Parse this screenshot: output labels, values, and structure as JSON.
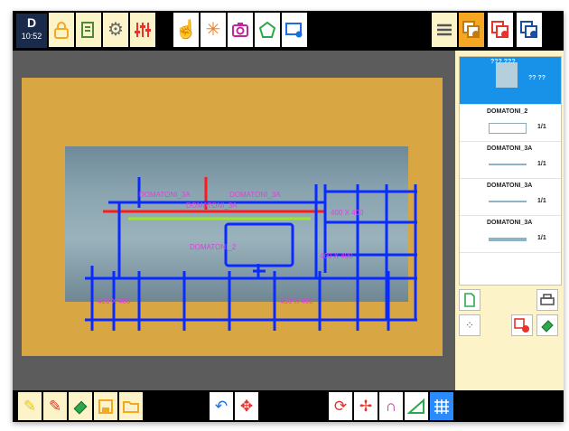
{
  "status": {
    "time": "10:52",
    "logo": "D"
  },
  "toolbar": {
    "lock_icon": "lock-icon",
    "menu_icon": "hamburger-icon"
  },
  "canvas": {
    "labels": [
      "DOMATONI_3A",
      "DOMATONI_3A",
      "DOMATONI_3A",
      "DOMATONI_2",
      "400 X 400",
      "400 X 400",
      "400 X 400",
      "400 X 400"
    ]
  },
  "layers": [
    {
      "name": "??? ???",
      "count": "?? ??"
    },
    {
      "name": "DOMATONI_2",
      "count": "1/1"
    },
    {
      "name": "DOMATONI_3A",
      "count": "1/1"
    },
    {
      "name": "DOMATONI_3A",
      "count": "1/1"
    },
    {
      "name": "DOMATONI_3A",
      "count": "1/1"
    }
  ],
  "colors": {
    "accent_orange": "#f5a623",
    "panel_bg": "#fdf3c8",
    "selection_blue": "#1891e8",
    "grid_blue": "#0a2bff",
    "cut_red": "#ff1a1a",
    "guide_green": "#9be82a",
    "label_pink": "#e53de0"
  }
}
